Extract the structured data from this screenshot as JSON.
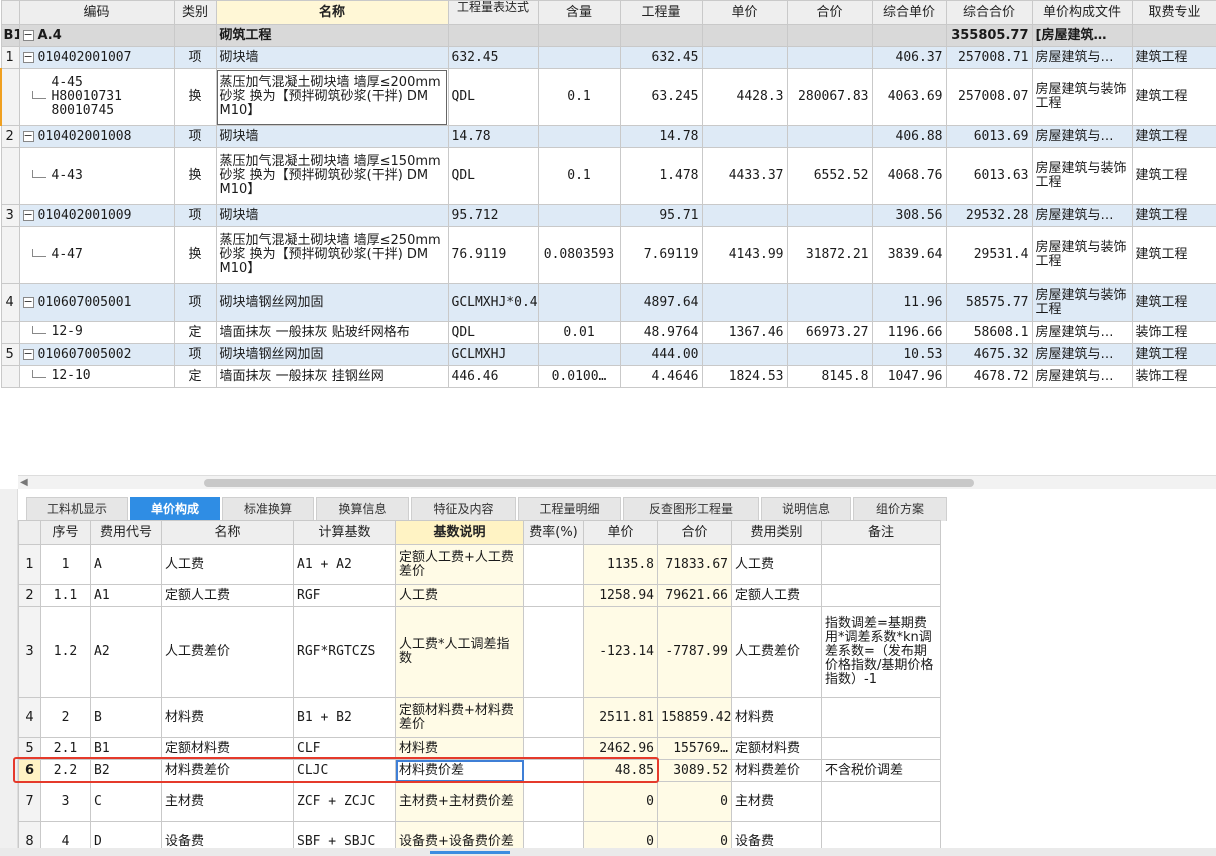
{
  "top_table": {
    "headers": [
      "",
      "编码",
      "类别",
      "名称",
      "工程量表达式",
      "含量",
      "工程量",
      "单价",
      "合价",
      "综合单价",
      "综合合价",
      "单价构成文件",
      "取费专业"
    ],
    "group": {
      "label": "B1",
      "code": "A.4",
      "name": "砌筑工程",
      "total": "355805.77",
      "file": "[房屋建筑…"
    },
    "rows": [
      {
        "rn": "1",
        "kind": "item",
        "code": "010402001007",
        "type": "项",
        "name": "砌块墙",
        "expr": "632.45",
        "content": "",
        "qty": "632.45",
        "price": "",
        "amount": "",
        "comp_price": "406.37",
        "comp_amount": "257008.71",
        "file": "房屋建筑与…",
        "major": "建筑工程"
      },
      {
        "rn": "",
        "kind": "sub",
        "code": "4-45\nH80010731\n80010745",
        "type": "换",
        "name": "蒸压加气混凝土砌块墙 墙厚≤200mm 砂浆  换为【预拌砌筑砂浆(干拌) DM M10】",
        "expr": "QDL",
        "content": "0.1",
        "qty": "63.245",
        "price": "4428.3",
        "amount": "280067.83",
        "comp_price": "4063.69",
        "comp_amount": "257008.07",
        "file": "房屋建筑与装饰工程",
        "major": "建筑工程"
      },
      {
        "rn": "2",
        "kind": "item",
        "code": "010402001008",
        "type": "项",
        "name": "砌块墙",
        "expr": "14.78",
        "content": "",
        "qty": "14.78",
        "price": "",
        "amount": "",
        "comp_price": "406.88",
        "comp_amount": "6013.69",
        "file": "房屋建筑与…",
        "major": "建筑工程"
      },
      {
        "rn": "",
        "kind": "sub",
        "code": "4-43",
        "type": "换",
        "name": "蒸压加气混凝土砌块墙 墙厚≤150mm 砂浆  换为【预拌砌筑砂浆(干拌) DM M10】",
        "expr": "QDL",
        "content": "0.1",
        "qty": "1.478",
        "price": "4433.37",
        "amount": "6552.52",
        "comp_price": "4068.76",
        "comp_amount": "6013.63",
        "file": "房屋建筑与装饰工程",
        "major": "建筑工程"
      },
      {
        "rn": "3",
        "kind": "item",
        "code": "010402001009",
        "type": "项",
        "name": "砌块墙",
        "expr": "95.712",
        "content": "",
        "qty": "95.71",
        "price": "",
        "amount": "",
        "comp_price": "308.56",
        "comp_amount": "29532.28",
        "file": "房屋建筑与…",
        "major": "建筑工程"
      },
      {
        "rn": "",
        "kind": "sub",
        "code": "4-47",
        "type": "换",
        "name": "蒸压加气混凝土砌块墙 墙厚≤250mm 砂浆  换为【预拌砌筑砂浆(干拌) DM M10】",
        "expr": "76.9119",
        "content": "0.0803593",
        "qty": "7.69119",
        "price": "4143.99",
        "amount": "31872.21",
        "comp_price": "3839.64",
        "comp_amount": "29531.4",
        "file": "房屋建筑与装饰工程",
        "major": "建筑工程"
      },
      {
        "rn": "4",
        "kind": "item",
        "code": "010607005001",
        "type": "项",
        "name": "砌块墙钢丝网加固",
        "expr": "GCLMXHJ*0.4",
        "content": "",
        "qty": "4897.64",
        "price": "",
        "amount": "",
        "comp_price": "11.96",
        "comp_amount": "58575.77",
        "file": "房屋建筑与装饰工程",
        "major": "建筑工程"
      },
      {
        "rn": "",
        "kind": "sub",
        "code": "12-9",
        "type": "定",
        "name": "墙面抹灰 一般抹灰 贴玻纤网格布",
        "expr": "QDL",
        "content": "0.01",
        "qty": "48.9764",
        "price": "1367.46",
        "amount": "66973.27",
        "comp_price": "1196.66",
        "comp_amount": "58608.1",
        "file": "房屋建筑与…",
        "major": "装饰工程"
      },
      {
        "rn": "5",
        "kind": "item",
        "code": "010607005002",
        "type": "项",
        "name": "砌块墙钢丝网加固",
        "expr": "GCLMXHJ",
        "content": "",
        "qty": "444.00",
        "price": "",
        "amount": "",
        "comp_price": "10.53",
        "comp_amount": "4675.32",
        "file": "房屋建筑与…",
        "major": "建筑工程"
      },
      {
        "rn": "",
        "kind": "sub",
        "code": "12-10",
        "type": "定",
        "name": "墙面抹灰 一般抹灰 挂钢丝网",
        "expr": "446.46",
        "content": "0.0100…",
        "qty": "4.4646",
        "price": "1824.53",
        "amount": "8145.8",
        "comp_price": "1047.96",
        "comp_amount": "4678.72",
        "file": "房屋建筑与…",
        "major": "装饰工程"
      }
    ]
  },
  "tabs": [
    "工料机显示",
    "单价构成",
    "标准换算",
    "换算信息",
    "特征及内容",
    "工程量明细",
    "反查图形工程量",
    "说明信息",
    "组价方案"
  ],
  "active_tab": 1,
  "bottom_table": {
    "headers": [
      "",
      "序号",
      "费用代号",
      "名称",
      "计算基数",
      "基数说明",
      "费率(%)",
      "单价",
      "合价",
      "费用类别",
      "备注"
    ],
    "rows": [
      {
        "rn": "1",
        "seq": "1",
        "code": "A",
        "name": "人工费",
        "base": "A1 + A2",
        "desc": "定额人工费+人工费差价",
        "rate": "",
        "price": "1135.8",
        "amount": "71833.67",
        "cat": "人工费",
        "note": ""
      },
      {
        "rn": "2",
        "seq": "1.1",
        "code": "A1",
        "name": "定额人工费",
        "base": "RGF",
        "desc": "人工费",
        "rate": "",
        "price": "1258.94",
        "amount": "79621.66",
        "cat": "定额人工费",
        "note": ""
      },
      {
        "rn": "3",
        "seq": "1.2",
        "code": "A2",
        "name": "人工费差价",
        "base": "RGF*RGTCZS",
        "desc": "人工费*人工调差指数",
        "rate": "",
        "price": "-123.14",
        "amount": "-7787.99",
        "cat": "人工费差价",
        "note": "指数调差=基期费用*调差系数*kn调差系数=（发布期价格指数/基期价格指数）-1"
      },
      {
        "rn": "4",
        "seq": "2",
        "code": "B",
        "name": "材料费",
        "base": "B1 + B2",
        "desc": "定额材料费+材料费差价",
        "rate": "",
        "price": "2511.81",
        "amount": "158859.42",
        "cat": "材料费",
        "note": ""
      },
      {
        "rn": "5",
        "seq": "2.1",
        "code": "B1",
        "name": "定额材料费",
        "base": "CLF",
        "desc": "材料费",
        "rate": "",
        "price": "2462.96",
        "amount": "155769…",
        "cat": "定额材料费",
        "note": ""
      },
      {
        "rn": "6",
        "seq": "2.2",
        "code": "B2",
        "name": "材料费差价",
        "base": "CLJC",
        "desc": "材料费价差",
        "rate": "",
        "price": "48.85",
        "amount": "3089.52",
        "cat": "材料费差价",
        "note": "不含税价调差"
      },
      {
        "rn": "7",
        "seq": "3",
        "code": "C",
        "name": "主材费",
        "base": "ZCF + ZCJC",
        "desc": "主材费+主材费价差",
        "rate": "",
        "price": "0",
        "amount": "0",
        "cat": "主材费",
        "note": ""
      },
      {
        "rn": "8",
        "seq": "4",
        "code": "D",
        "name": "设备费",
        "base": "SBF + SBJC",
        "desc": "设备费+设备费价差",
        "rate": "",
        "price": "0",
        "amount": "0",
        "cat": "设备费",
        "note": ""
      }
    ]
  }
}
